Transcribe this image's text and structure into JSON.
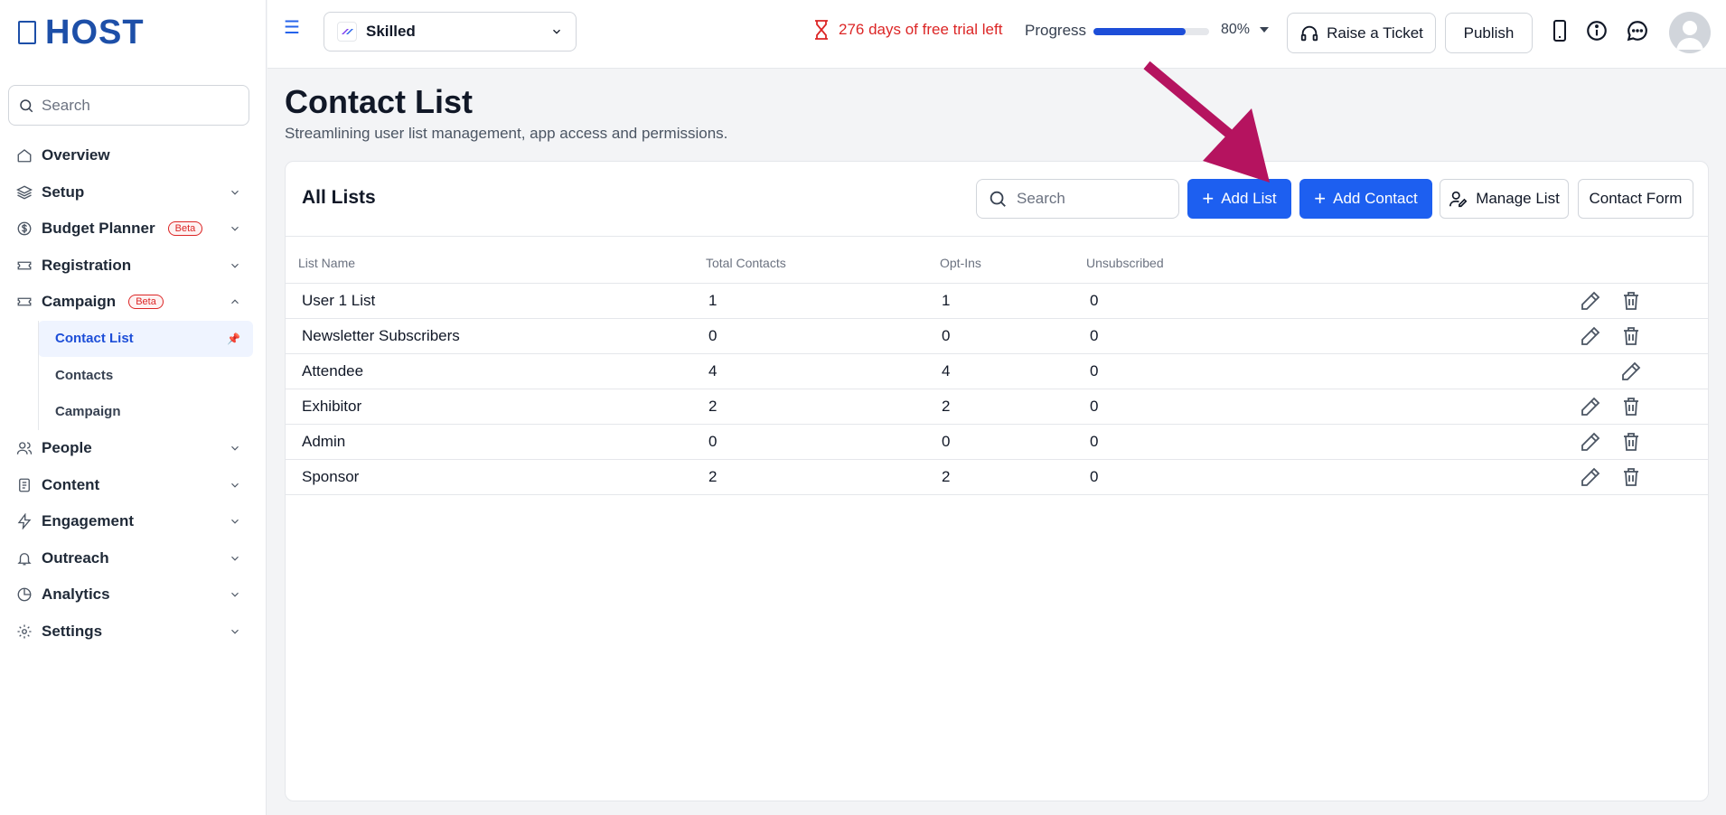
{
  "sidebar": {
    "logo": "HOST",
    "search_placeholder": "Search",
    "items": [
      {
        "label": "Overview",
        "icon": "home-icon"
      },
      {
        "label": "Setup",
        "icon": "layers-icon"
      },
      {
        "label": "Budget Planner",
        "icon": "dollar-icon",
        "badge": "Beta"
      },
      {
        "label": "Registration",
        "icon": "ticket-icon"
      },
      {
        "label": "Campaign",
        "icon": "ticket-icon",
        "badge": "Beta"
      },
      {
        "label": "People",
        "icon": "users-icon"
      },
      {
        "label": "Content",
        "icon": "document-icon"
      },
      {
        "label": "Engagement",
        "icon": "bolt-icon"
      },
      {
        "label": "Outreach",
        "icon": "bell-icon"
      },
      {
        "label": "Analytics",
        "icon": "pie-chart-icon"
      },
      {
        "label": "Settings",
        "icon": "gear-icon"
      }
    ],
    "campaign_sub": [
      "Contact List",
      "Contacts",
      "Campaign"
    ]
  },
  "header": {
    "event_name": "Skilled",
    "trial_text": "276 days of free trial left",
    "progress_label": "Progress",
    "progress_value": 0.8,
    "progress_pct": "80%",
    "ticket_label": "Raise a Ticket",
    "publish_label": "Publish"
  },
  "main": {
    "title": "Contact List",
    "subtitle": "Streamlining user list management, app access and permissions.",
    "card_title": "All Lists",
    "search_placeholder": "Search",
    "add_list_label": "Add List",
    "add_contact_label": "Add Contact",
    "manage_list_label": "Manage List",
    "contact_form_label": "Contact Form",
    "columns": [
      "List Name",
      "Total Contacts",
      "Opt-Ins",
      "Unsubscribed"
    ],
    "rows": [
      {
        "name": "User 1 List",
        "total": "1",
        "optins": "1",
        "unsub": "0",
        "deletable": true
      },
      {
        "name": "Newsletter Subscribers",
        "total": "0",
        "optins": "0",
        "unsub": "0",
        "deletable": true
      },
      {
        "name": "Attendee",
        "total": "4",
        "optins": "4",
        "unsub": "0",
        "deletable": false
      },
      {
        "name": "Exhibitor",
        "total": "2",
        "optins": "2",
        "unsub": "0",
        "deletable": true
      },
      {
        "name": "Admin",
        "total": "0",
        "optins": "0",
        "unsub": "0",
        "deletable": true
      },
      {
        "name": "Sponsor",
        "total": "2",
        "optins": "2",
        "unsub": "0",
        "deletable": true
      }
    ]
  },
  "colors": {
    "brand": "#1d4fa8",
    "primary": "#1d5ff0",
    "danger": "#dc2626",
    "annotation": "#b5135f"
  }
}
